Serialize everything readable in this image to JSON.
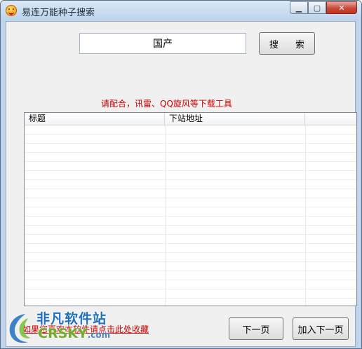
{
  "window": {
    "title": "易连万能种子搜索"
  },
  "search": {
    "value": "国产",
    "button_label": "搜 索"
  },
  "notice": "请配合，讯雷、QQ旋风等下载工具",
  "table": {
    "columns": [
      "标题",
      "下站地址",
      ""
    ],
    "rows": []
  },
  "footer": {
    "link_text": "如果您喜欢本软件请点击此处收藏",
    "next_label": "下一页",
    "add_next_label": "加入下一页"
  },
  "watermark": {
    "name": "非凡软件站",
    "domain": "CRSKY",
    "tld": ".com"
  },
  "colors": {
    "notice": "#cc0000",
    "title_bar": "#bcd3ec",
    "close_button": "#c43222"
  }
}
